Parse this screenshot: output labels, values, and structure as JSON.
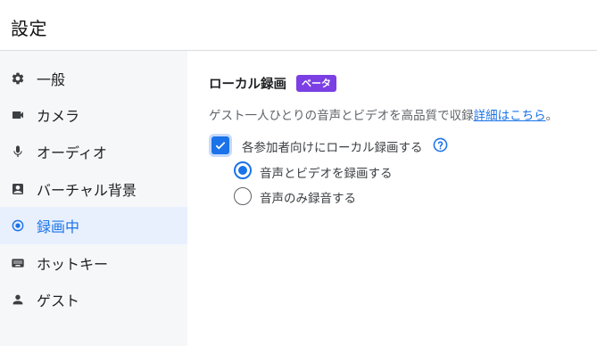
{
  "header": {
    "title": "設定"
  },
  "sidebar": {
    "items": [
      {
        "label": "一般",
        "icon": "gear-icon",
        "active": false
      },
      {
        "label": "カメラ",
        "icon": "camera-icon",
        "active": false
      },
      {
        "label": "オーディオ",
        "icon": "microphone-icon",
        "active": false
      },
      {
        "label": "バーチャル背景",
        "icon": "portrait-icon",
        "active": false
      },
      {
        "label": "録画中",
        "icon": "record-icon",
        "active": true
      },
      {
        "label": "ホットキー",
        "icon": "keyboard-icon",
        "active": false
      },
      {
        "label": "ゲスト",
        "icon": "person-icon",
        "active": false
      }
    ]
  },
  "recording": {
    "title": "ローカル録画",
    "badge": "ベータ",
    "description": "ゲスト一人ひとりの音声とビデオを高品質で収録",
    "details_link": "詳細はこちら",
    "description_end": "。",
    "checkbox_label": "各参加者向けにローカル録画する",
    "checkbox_checked": true,
    "options": [
      {
        "label": "音声とビデオを録画する",
        "selected": true
      },
      {
        "label": "音声のみ録音する",
        "selected": false
      }
    ]
  },
  "colors": {
    "accent": "#1a73e8",
    "badge": "#7b3fe4",
    "sidebar_bg": "#f6f7f9",
    "active_bg": "#e8f0fe"
  }
}
